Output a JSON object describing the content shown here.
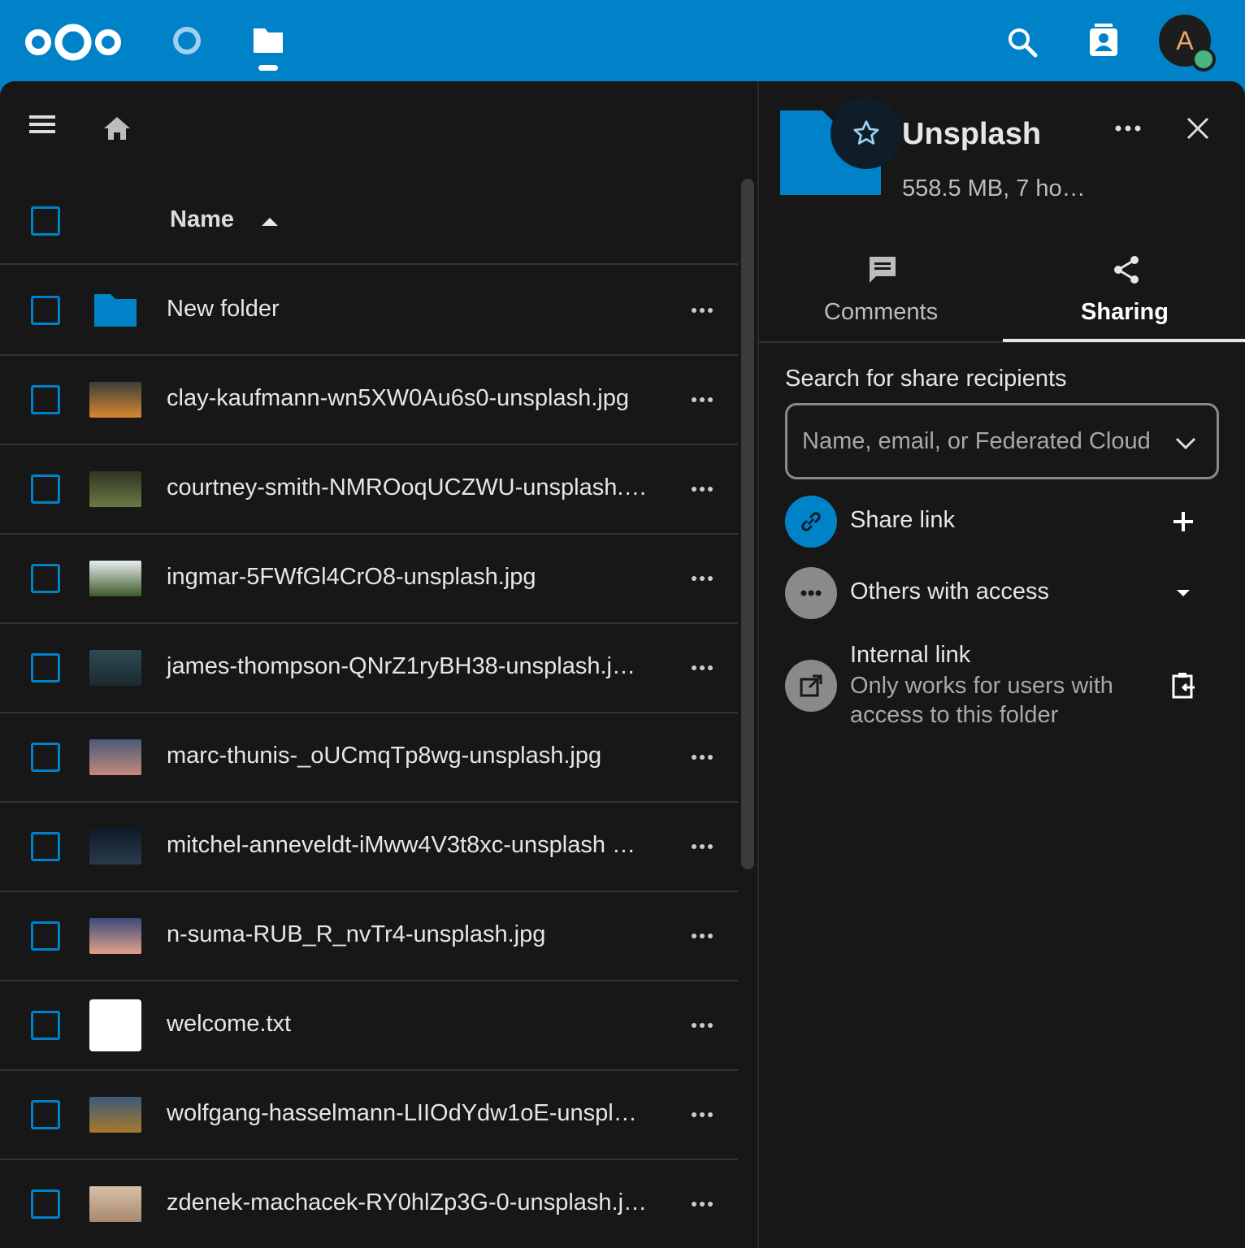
{
  "header": {
    "avatar_initial": "A",
    "apps": [
      "nextcloud-logo",
      "dashboard-icon",
      "files-icon"
    ],
    "actions": [
      "search-icon",
      "contacts-icon"
    ]
  },
  "filelist": {
    "column_name": "Name",
    "files": [
      {
        "name": "New folder",
        "type": "folder"
      },
      {
        "name": "clay-kaufmann-wn5XW0Au6s0-unsplash.jpg",
        "type": "image",
        "thumb": [
          "#3a3f3a",
          "#d9882f"
        ]
      },
      {
        "name": "courtney-smith-NMROoqUCZWU-unsplash.…",
        "type": "image",
        "thumb": [
          "#2e3522",
          "#6b7a44"
        ]
      },
      {
        "name": "ingmar-5FWfGl4CrO8-unsplash.jpg",
        "type": "image",
        "thumb": [
          "#e8ecef",
          "#3d5a2a"
        ]
      },
      {
        "name": "james-thompson-QNrZ1ryBH38-unsplash.j…",
        "type": "image",
        "thumb": [
          "#2d4a52",
          "#1a2b30"
        ]
      },
      {
        "name": "marc-thunis-_oUCmqTp8wg-unsplash.jpg",
        "type": "image",
        "thumb": [
          "#4b5a7a",
          "#c48a7a"
        ]
      },
      {
        "name": "mitchel-anneveldt-iMww4V3t8xc-unsplash …",
        "type": "image",
        "thumb": [
          "#0e1a2a",
          "#2a3a4a"
        ]
      },
      {
        "name": "n-suma-RUB_R_nvTr4-unsplash.jpg",
        "type": "image",
        "thumb": [
          "#3a4a7a",
          "#e0a08a"
        ]
      },
      {
        "name": "welcome.txt",
        "type": "text"
      },
      {
        "name": "wolfgang-hasselmann-LIIOdYdw1oE-unspl…",
        "type": "image",
        "thumb": [
          "#3a5a7a",
          "#a87a2a"
        ]
      },
      {
        "name": "zdenek-machacek-RY0hlZp3G-0-unsplash.j…",
        "type": "image",
        "thumb": [
          "#d8c0a8",
          "#a88870"
        ]
      }
    ]
  },
  "sidebar": {
    "title": "Unsplash",
    "subtitle": "558.5 MB, 7 ho…",
    "tabs": [
      {
        "label": "Comments"
      },
      {
        "label": "Sharing"
      }
    ],
    "search_label": "Search for share recipients",
    "search_placeholder": "Name, email, or Federated Cloud ID …",
    "share_link": "Share link",
    "others_access": "Others with access",
    "internal_link": "Internal link",
    "internal_link_desc": "Only works for users with access to this folder"
  },
  "colors": {
    "brand": "#0082c9",
    "background": "#171717",
    "online": "#49b382"
  }
}
